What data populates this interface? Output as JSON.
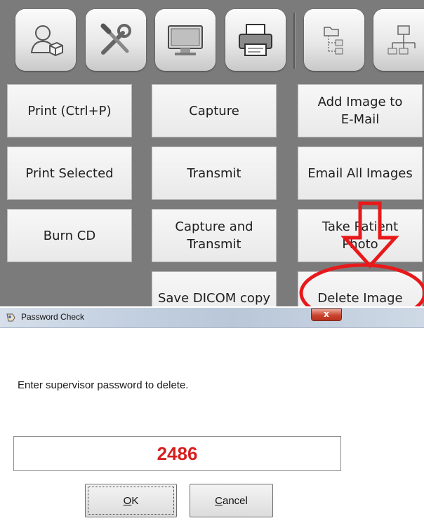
{
  "toolbar": {
    "icons": [
      "user-icon",
      "tools-icon",
      "monitor-icon",
      "printer-icon",
      "folder-tree-icon",
      "network-icon"
    ]
  },
  "actions": {
    "print": "Print (Ctrl+P)",
    "capture": "Capture",
    "add_image_email": "Add Image to\nE-Mail",
    "print_selected": "Print Selected",
    "transmit": "Transmit",
    "email_all": "Email All Images",
    "burn_cd": "Burn CD",
    "capture_transmit": "Capture and\nTransmit",
    "take_patient_photo": "Take Patient\nPhoto",
    "save_dicom": "Save DICOM copy",
    "delete_image": "Delete Image"
  },
  "annotation": {
    "color": "#e8191b"
  },
  "dialog": {
    "title": "Password Check",
    "close_glyph": "x",
    "prompt": "Enter supervisor password to delete.",
    "password_value": "2486",
    "ok_mnemonic": "O",
    "ok_rest": "K",
    "cancel_mnemonic": "C",
    "cancel_rest": "ancel"
  }
}
